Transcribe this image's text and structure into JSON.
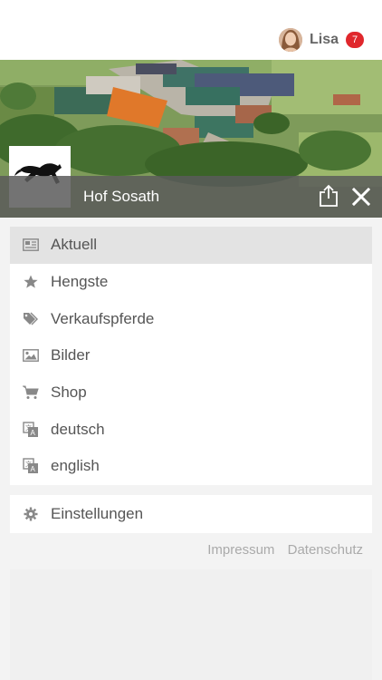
{
  "user": {
    "name": "Lisa",
    "notifications": "7"
  },
  "header": {
    "title": "Hof Sosath"
  },
  "menu": {
    "items": [
      {
        "label": "Aktuell",
        "icon": "newspaper-icon",
        "active": true
      },
      {
        "label": "Hengste",
        "icon": "star-icon"
      },
      {
        "label": "Verkaufspferde",
        "icon": "tags-icon"
      },
      {
        "label": "Bilder",
        "icon": "image-icon"
      },
      {
        "label": "Shop",
        "icon": "cart-icon"
      },
      {
        "label": "deutsch",
        "icon": "translate-icon"
      },
      {
        "label": "english",
        "icon": "translate-icon"
      }
    ],
    "settings_label": "Einstellungen"
  },
  "footer": {
    "impressum": "Impressum",
    "datenschutz": "Datenschutz"
  },
  "colors": {
    "badge": "#e0272c",
    "active_row": "#e3e3e3",
    "titlebar": "#5a5a5a"
  }
}
